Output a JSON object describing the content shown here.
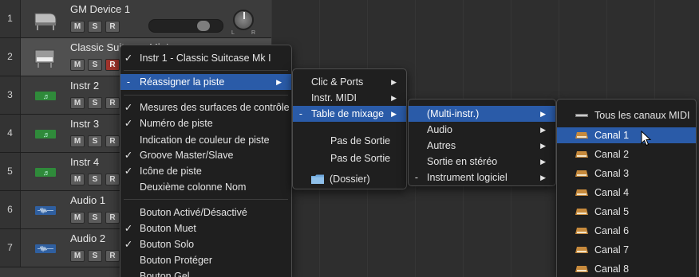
{
  "tracks": [
    {
      "num": "1",
      "name": "GM Device 1",
      "type": "gm",
      "mute": "M",
      "solo": "S",
      "rec": "R",
      "pan_l": "L",
      "pan_r": "R"
    },
    {
      "num": "2",
      "name": "Classic Suitcase Mk I",
      "type": "piano",
      "mute": "M",
      "solo": "S",
      "rec": "R"
    },
    {
      "num": "3",
      "name": "Instr  2",
      "type": "midi",
      "mute": "M",
      "solo": "S",
      "rec": "R"
    },
    {
      "num": "4",
      "name": "Instr  3",
      "type": "midi",
      "mute": "M",
      "solo": "S",
      "rec": "R"
    },
    {
      "num": "5",
      "name": "Instr  4",
      "type": "midi",
      "mute": "M",
      "solo": "S",
      "rec": "R"
    },
    {
      "num": "6",
      "name": "Audio  1",
      "type": "audio",
      "mute": "M",
      "solo": "S",
      "rec": "R"
    },
    {
      "num": "7",
      "name": "Audio  2",
      "type": "audio",
      "mute": "M",
      "solo": "S",
      "rec": "R"
    }
  ],
  "menu1": {
    "items": [
      {
        "check": "✓",
        "label": "Instr 1 - Classic Suitcase Mk I"
      },
      {
        "check": "-",
        "label": "Réassigner la piste",
        "submenu": true,
        "highlighted": true
      },
      {
        "check": "✓",
        "label": "Mesures des surfaces de contrôle"
      },
      {
        "check": "✓",
        "label": "Numéro de piste"
      },
      {
        "check": "",
        "label": "Indication de couleur de piste"
      },
      {
        "check": "✓",
        "label": "Groove Master/Slave"
      },
      {
        "check": "✓",
        "label": "Icône de piste"
      },
      {
        "check": "",
        "label": "Deuxième colonne Nom"
      },
      {
        "check": "",
        "label": "Bouton Activé/Désactivé"
      },
      {
        "check": "✓",
        "label": "Bouton Muet"
      },
      {
        "check": "✓",
        "label": "Bouton Solo"
      },
      {
        "check": "",
        "label": "Bouton Protéger"
      },
      {
        "check": "",
        "label": "Bouton Gel"
      }
    ]
  },
  "menu2": {
    "items": [
      {
        "check": "",
        "label": "Clic & Ports",
        "submenu": true
      },
      {
        "check": "",
        "label": "Instr. MIDI",
        "submenu": true
      },
      {
        "check": "-",
        "label": "Table de mixage",
        "submenu": true,
        "highlighted": true
      },
      {
        "check": "",
        "label": "Pas de Sortie"
      },
      {
        "check": "",
        "label": "Pas de Sortie"
      },
      {
        "check": "",
        "label": "(Dossier)"
      }
    ]
  },
  "menu3": {
    "items": [
      {
        "check": "",
        "label": "(Multi-instr.)",
        "submenu": true,
        "highlighted": true
      },
      {
        "check": "",
        "label": "Audio",
        "submenu": true
      },
      {
        "check": "",
        "label": "Autres",
        "submenu": true
      },
      {
        "check": "",
        "label": "Sortie en stéréo",
        "submenu": true
      },
      {
        "check": "-",
        "label": "Instrument logiciel",
        "submenu": true
      }
    ]
  },
  "menu4": {
    "items": [
      {
        "label": "Tous les canaux MIDI"
      },
      {
        "label": "Canal  1",
        "highlighted": true
      },
      {
        "label": "Canal  2"
      },
      {
        "label": "Canal  3"
      },
      {
        "label": "Canal  4"
      },
      {
        "label": "Canal  5"
      },
      {
        "label": "Canal  6"
      },
      {
        "label": "Canal  7"
      },
      {
        "label": "Canal  8"
      }
    ]
  },
  "icons": {
    "submenu_arrow": "triangle-right-icon",
    "folder": "folder-icon",
    "cursor": "mouse-pointer-icon"
  },
  "colors": {
    "highlight": "#2a5ba8",
    "record_on": "#a0342c",
    "midi_region": "#2f8a3a",
    "audio_region": "#2f5fa0"
  }
}
